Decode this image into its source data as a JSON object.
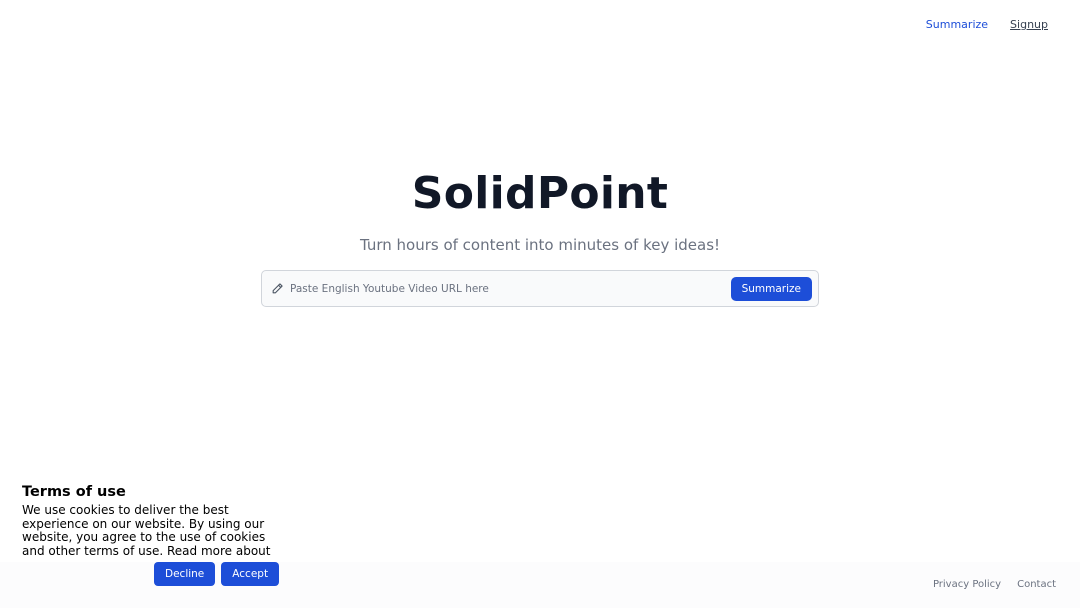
{
  "nav": {
    "summarize_label": "Summarize",
    "signup_label": "Signup"
  },
  "hero": {
    "title": "SolidPoint",
    "subtitle": "Turn hours of content into minutes of key ideas!"
  },
  "search": {
    "placeholder": "Paste English Youtube Video URL here",
    "button_label": "Summarize",
    "icon": "pencil-icon"
  },
  "cookie": {
    "title": "Terms of use",
    "text": "We use cookies to deliver the best experience on our website. By using our website, you agree to the use of cookies and other terms of use. Read more about",
    "decline_label": "Decline",
    "accept_label": "Accept"
  },
  "footer": {
    "privacy_label": "Privacy Policy",
    "contact_label": "Contact"
  },
  "colors": {
    "accent": "#1d4ed8",
    "title": "#111827",
    "muted": "#6b7280"
  }
}
